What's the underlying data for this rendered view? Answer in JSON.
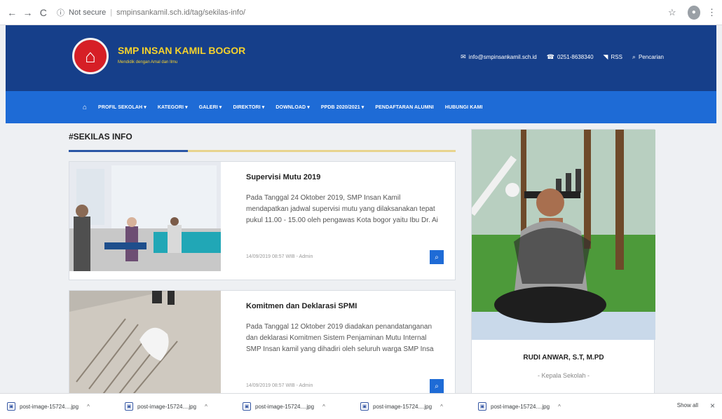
{
  "browser": {
    "back_icon": "←",
    "forward_icon": "→",
    "reload_icon": "C",
    "security_label": "Not secure",
    "url": "smpinsankamil.sch.id/tag/sekilas-info/",
    "star_icon": "☆",
    "kebab_icon": "⋮"
  },
  "site": {
    "logo_glyph": "⌂",
    "title": "SMP INSAN KAMIL BOGOR",
    "tagline": "Mendidik dengan Amal dan Ilmu",
    "contacts": [
      {
        "icon": "✉",
        "label": "info@smpinsankamil.sch.id"
      },
      {
        "icon": "☎",
        "label": "0251-8638340"
      },
      {
        "icon": "◥",
        "label": "RSS"
      },
      {
        "icon": "⌕",
        "label": "Pencarian"
      }
    ]
  },
  "nav": {
    "home_icon": "⌂",
    "items": [
      "PROFIL SEKOLAH ▾",
      "KATEGORI ▾",
      "GALERI ▾",
      "DIREKTORI ▾",
      "DOWNLOAD ▾",
      "PPDB 2020/2021 ▾",
      "PENDAFTARAN ALUMNI",
      "HUBUNGI KAMI"
    ]
  },
  "content": {
    "title": "#SEKILAS INFO",
    "posts": [
      {
        "title": "Supervisi Mutu 2019",
        "excerpt": "Pada Tanggal 24 Oktober 2019, SMP Insan Kamil mendapatkan jadwal supervisi mutu yang dilaksanakan tepat pukul 11.00 - 15.00 oleh pengawas Kota bogor yaitu Ibu Dr. Ai",
        "meta": "14/09/2019 08:57 WIB - Admin",
        "button_icon": "⌕"
      },
      {
        "title": "Komitmen dan Deklarasi SPMI",
        "excerpt": "Pada Tanggal 12 Oktober 2019 diadakan penandatanganan dan deklarasi Komitmen Sistem Penjaminan Mutu Internal SMP Insan kamil yang dihadiri oleh seluruh warga SMP Insa",
        "meta": "14/09/2019 08:57 WIB - Admin",
        "button_icon": "⌕"
      }
    ]
  },
  "sidebar": {
    "name": "RUDI ANWAR, S.T, M.PD",
    "role": "- Kepala Sekolah -"
  },
  "downloads": {
    "items": [
      {
        "icon": "▣",
        "label": "post-image-15724....jpg",
        "caret": "^"
      },
      {
        "icon": "▣",
        "label": "post-image-15724....jpg",
        "caret": "^"
      },
      {
        "icon": "▣",
        "label": "post-image-15724....jpg",
        "caret": "^"
      },
      {
        "icon": "▣",
        "label": "post-image-15724....jpg",
        "caret": "^"
      },
      {
        "icon": "▣",
        "label": "post-image-15724....jpg",
        "caret": "^"
      }
    ],
    "show_all": "Show all",
    "close_icon": "×"
  }
}
